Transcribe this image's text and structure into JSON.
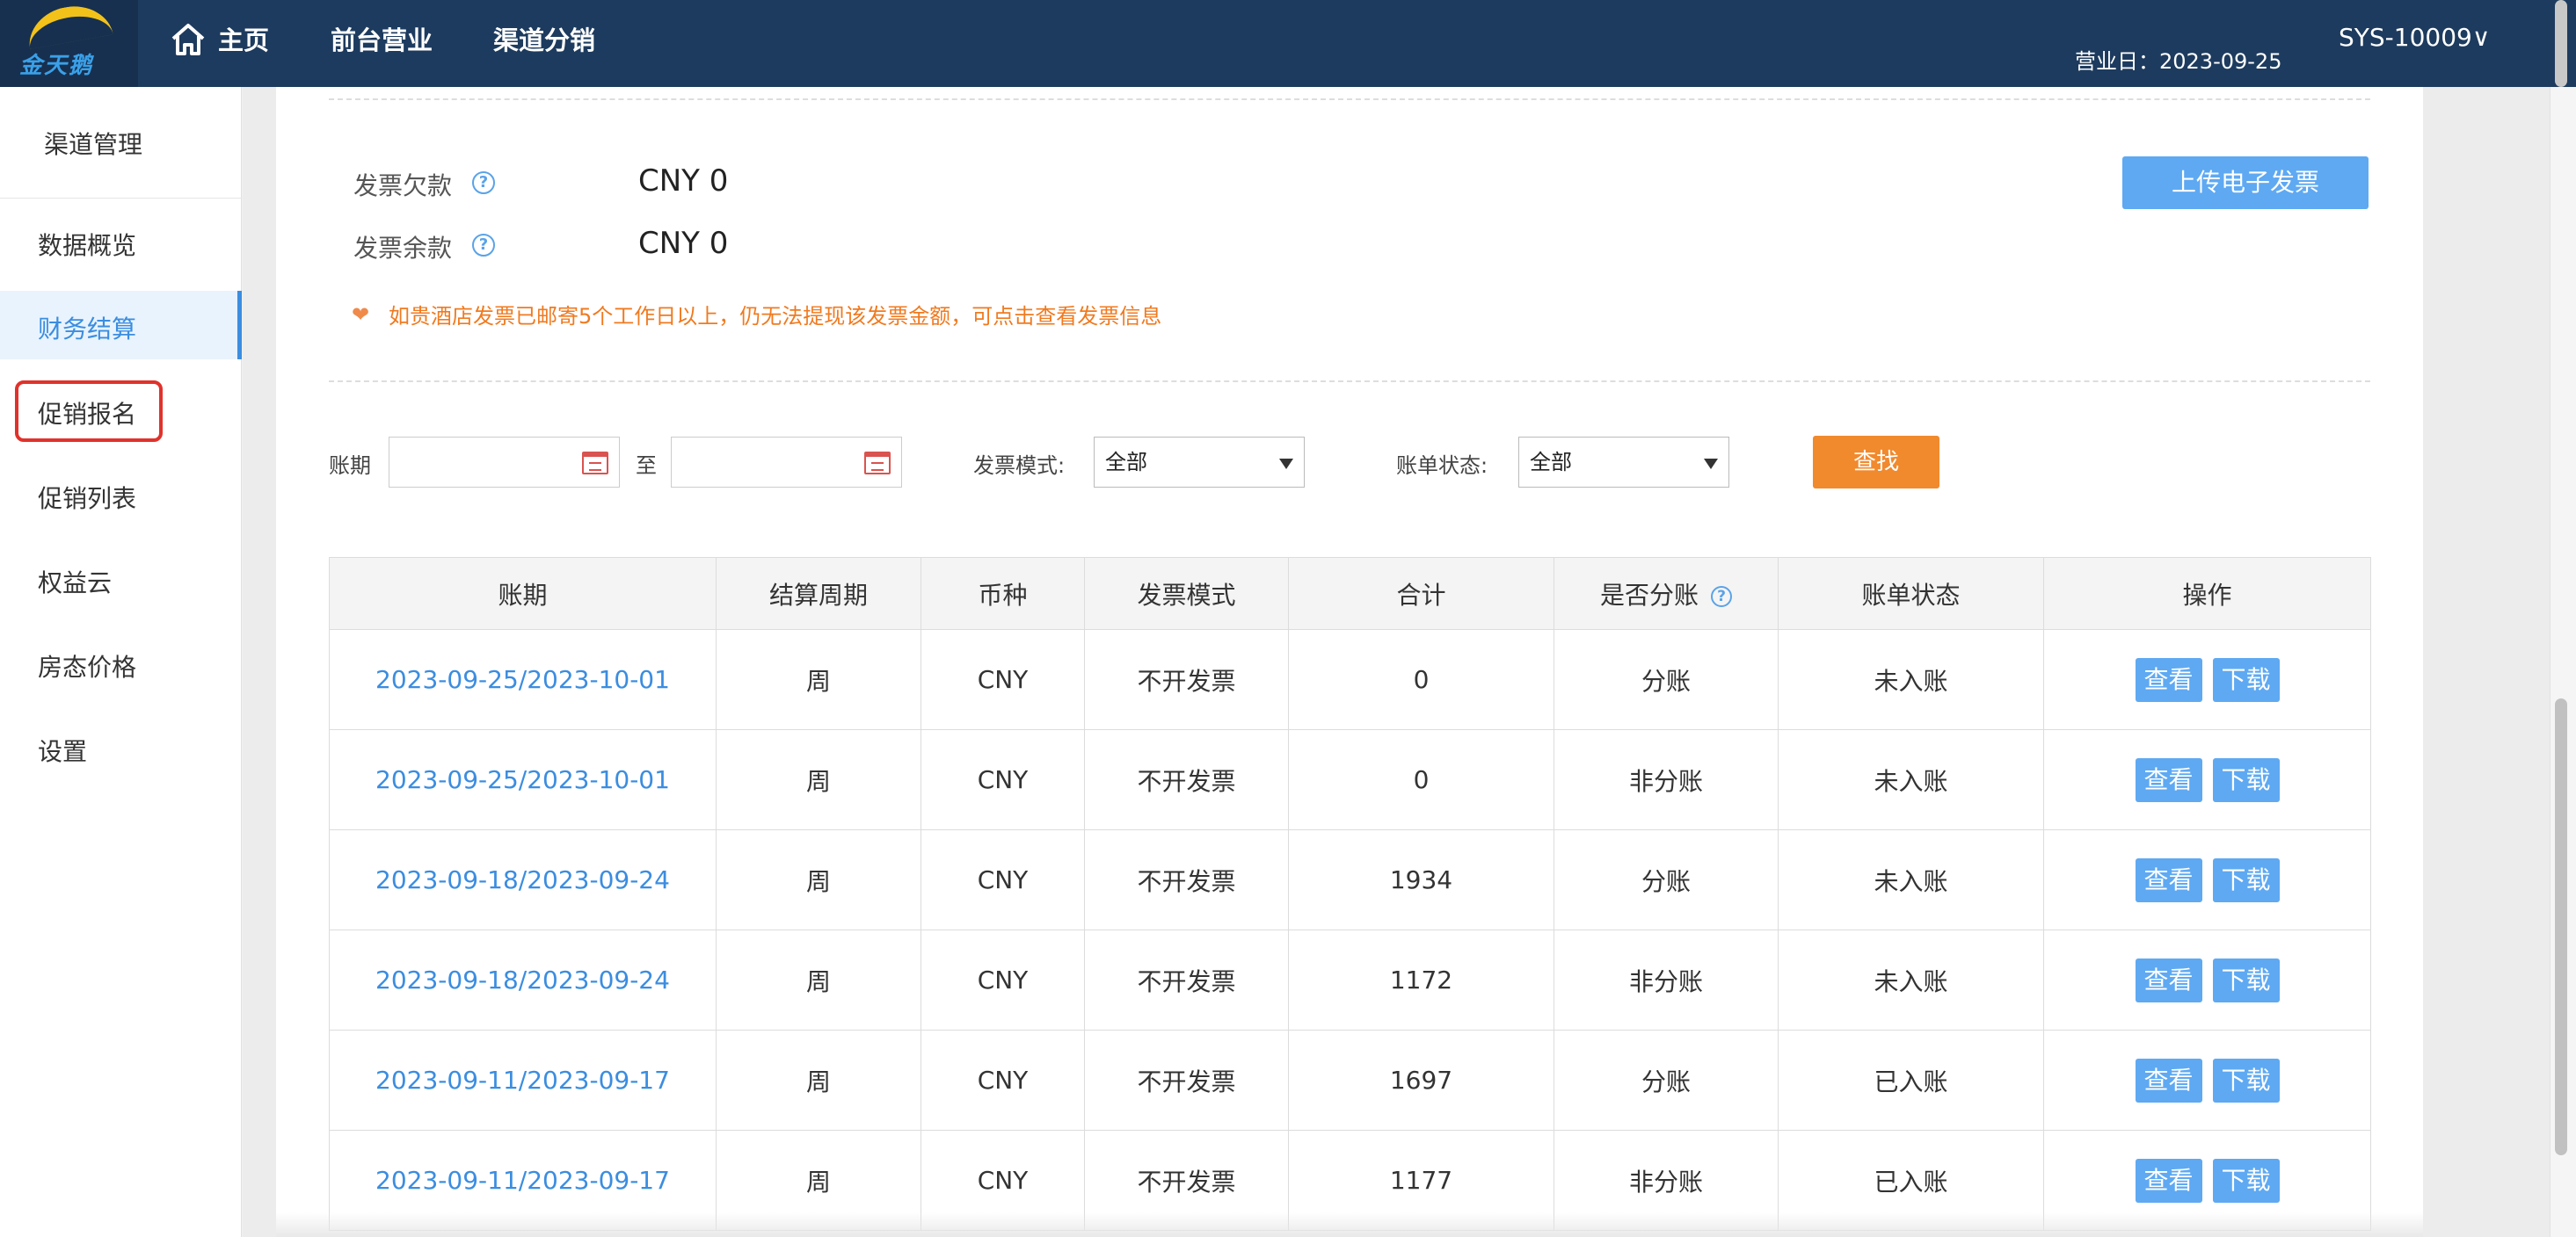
{
  "header": {
    "logo_text": "金天鹅",
    "nav": [
      {
        "label": "主页"
      },
      {
        "label": "前台营业"
      },
      {
        "label": "渠道分销"
      }
    ],
    "business_date": "营业日：2023-09-25",
    "user": "SYS-10009∨"
  },
  "sidebar": {
    "title": "渠道管理",
    "items": [
      {
        "label": "数据概览"
      },
      {
        "label": "财务结算"
      },
      {
        "label": "促销报名"
      },
      {
        "label": "促销列表"
      },
      {
        "label": "权益云"
      },
      {
        "label": "房态价格"
      },
      {
        "label": "设置"
      }
    ],
    "active_index": 1
  },
  "invoice": {
    "arrears_label": "发票欠款",
    "arrears_value": "CNY 0",
    "balance_label": "发票余款",
    "balance_value": "CNY 0",
    "help_glyph": "?",
    "upload_label": "上传电子发票",
    "notice": "如贵酒店发票已邮寄5个工作日以上，仍无法提现该发票金额，可点击查看发票信息",
    "notice_icon": "heart-icon"
  },
  "filters": {
    "period_label": "账期",
    "to_label": "至",
    "period_from": "",
    "period_to": "",
    "mode_label": "发票模式:",
    "mode_value": "全部",
    "status_label": "账单状态:",
    "status_value": "全部",
    "search_label": "查找"
  },
  "table": {
    "headers": [
      "账期",
      "结算周期",
      "币种",
      "发票模式",
      "合计",
      "是否分账",
      "账单状态",
      "操作"
    ],
    "view_label": "查看",
    "download_label": "下载",
    "rows": [
      {
        "period": "2023-09-25/2023-10-01",
        "cycle": "周",
        "currency": "CNY",
        "mode": "不开发票",
        "total": "0",
        "split": "分账",
        "status": "未入账"
      },
      {
        "period": "2023-09-25/2023-10-01",
        "cycle": "周",
        "currency": "CNY",
        "mode": "不开发票",
        "total": "0",
        "split": "非分账",
        "status": "未入账"
      },
      {
        "period": "2023-09-18/2023-09-24",
        "cycle": "周",
        "currency": "CNY",
        "mode": "不开发票",
        "total": "1934",
        "split": "分账",
        "status": "未入账"
      },
      {
        "period": "2023-09-18/2023-09-24",
        "cycle": "周",
        "currency": "CNY",
        "mode": "不开发票",
        "total": "1172",
        "split": "非分账",
        "status": "未入账"
      },
      {
        "period": "2023-09-11/2023-09-17",
        "cycle": "周",
        "currency": "CNY",
        "mode": "不开发票",
        "total": "1697",
        "split": "分账",
        "status": "已入账"
      },
      {
        "period": "2023-09-11/2023-09-17",
        "cycle": "周",
        "currency": "CNY",
        "mode": "不开发票",
        "total": "1177",
        "split": "非分账",
        "status": "已入账"
      }
    ]
  },
  "colors": {
    "topbar": "#1d3b5e",
    "accent_blue": "#5ea9f2",
    "link_blue": "#3b8de0",
    "search_orange": "#f1892d",
    "notice_orange": "#f07a1f",
    "highlight_red": "#e0322b"
  }
}
